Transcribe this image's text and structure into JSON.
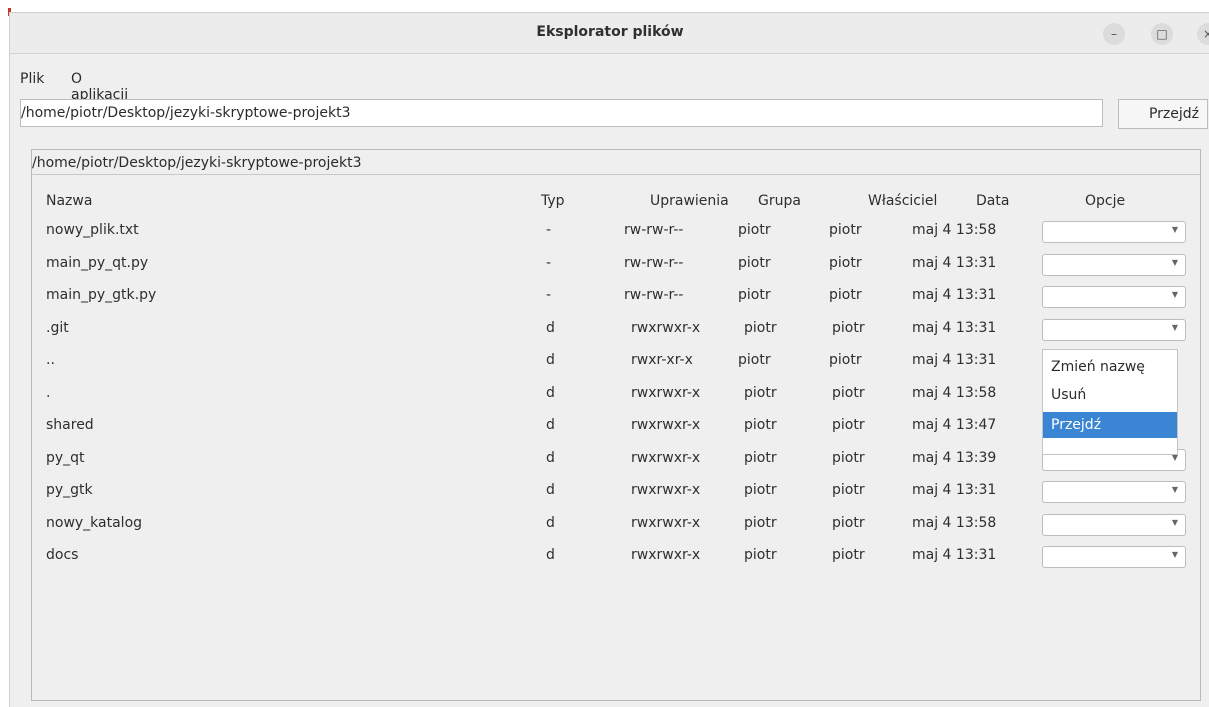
{
  "window": {
    "title": "Eksplorator plików",
    "controls": {
      "minimize": "–",
      "maximize": "□",
      "close": "×"
    }
  },
  "menu": {
    "items": [
      "Plik",
      "O aplikacji"
    ]
  },
  "address": {
    "value": "/home/piotr/Desktop/jezyki-skryptowe-projekt3",
    "button_label": "Przejdź"
  },
  "panel": {
    "title": "/home/piotr/Desktop/jezyki-skryptowe-projekt3",
    "columns": [
      "Nazwa",
      "Typ",
      "Uprawienia",
      "Grupa",
      "Właściciel",
      "Data",
      "Opcje"
    ],
    "rows": [
      {
        "name": "nowy_plik.txt",
        "type": "-",
        "perms": "rw-rw-r--",
        "group": "piotr",
        "owner": "piotr",
        "date": "maj  4 13:58"
      },
      {
        "name": "main_py_qt.py",
        "type": "-",
        "perms": "rw-rw-r--",
        "group": "piotr",
        "owner": "piotr",
        "date": "maj  4 13:31"
      },
      {
        "name": "main_py_gtk.py",
        "type": "-",
        "perms": "rw-rw-r--",
        "group": "piotr",
        "owner": "piotr",
        "date": "maj  4 13:31"
      },
      {
        "name": ".git",
        "type": "d",
        "perms": "rwxrwxr-x",
        "group": "piotr",
        "owner": "piotr",
        "date": "maj  4 13:31"
      },
      {
        "name": "..",
        "type": "d",
        "perms": "rwxr-xr-x",
        "group": "piotr",
        "owner": "piotr",
        "date": "maj  4 13:31"
      },
      {
        "name": ".",
        "type": "d",
        "perms": "rwxrwxr-x",
        "group": "piotr",
        "owner": "piotr",
        "date": "maj  4 13:58"
      },
      {
        "name": "shared",
        "type": "d",
        "perms": "rwxrwxr-x",
        "group": "piotr",
        "owner": "piotr",
        "date": "maj  4 13:47"
      },
      {
        "name": "py_qt",
        "type": "d",
        "perms": "rwxrwxr-x",
        "group": "piotr",
        "owner": "piotr",
        "date": "maj  4 13:39"
      },
      {
        "name": "py_gtk",
        "type": "d",
        "perms": "rwxrwxr-x",
        "group": "piotr",
        "owner": "piotr",
        "date": "maj  4 13:31"
      },
      {
        "name": "nowy_katalog",
        "type": "d",
        "perms": "rwxrwxr-x",
        "group": "piotr",
        "owner": "piotr",
        "date": "maj  4 13:58"
      },
      {
        "name": "docs",
        "type": "d",
        "perms": "rwxrwxr-x",
        "group": "piotr",
        "owner": "piotr",
        "date": "maj  4 13:31"
      }
    ]
  },
  "dropdown": {
    "items": [
      "Zmień nazwę",
      "Usuń",
      "Przejdź"
    ],
    "selected": "Przejdź"
  },
  "icons": {
    "combo_arrow": "chevron-down-icon"
  },
  "colors": {
    "accent": "#3b86d4",
    "window_bg": "#efefef"
  }
}
